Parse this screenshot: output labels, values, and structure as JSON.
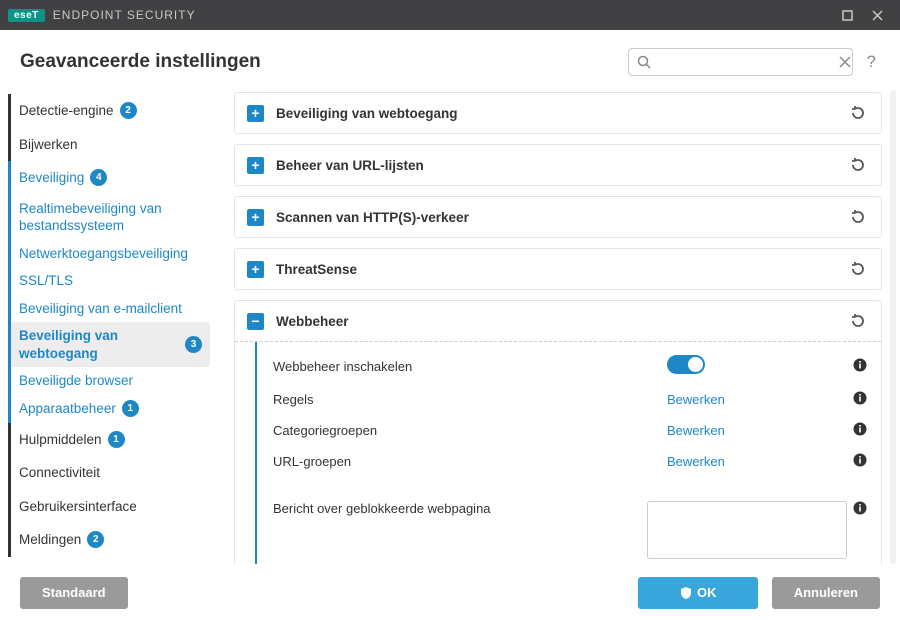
{
  "app": {
    "brand": "eseT",
    "name": "ENDPOINT SECURITY"
  },
  "page_title": "Geavanceerde instellingen",
  "search": {
    "placeholder": ""
  },
  "nav": {
    "detection": "Detectie-engine",
    "detection_badge": "2",
    "update": "Bijwerken",
    "protection": "Beveiliging",
    "protection_badge": "4",
    "sub_rtfs": "Realtimebeveiliging van bestandssysteem",
    "sub_network": "Netwerktoegangsbeveiliging",
    "sub_ssltls": "SSL/TLS",
    "sub_email": "Beveiliging van e-mailclient",
    "sub_webaccess": "Beveiliging van webtoegang",
    "sub_webaccess_badge": "3",
    "sub_secure_browser": "Beveiligde browser",
    "sub_device": "Apparaatbeheer",
    "sub_device_badge": "1",
    "tools": "Hulpmiddelen",
    "tools_badge": "1",
    "connectivity": "Connectiviteit",
    "ui": "Gebruikersinterface",
    "notifications": "Meldingen",
    "notifications_badge": "2"
  },
  "panels": {
    "web_security": "Beveiliging van webtoegang",
    "url_lists": "Beheer van URL-lijsten",
    "https_scan": "Scannen van HTTP(S)-verkeer",
    "threatsense": "ThreatSense",
    "webbeheer": "Webbeheer"
  },
  "webbeheer": {
    "enable_label": "Webbeheer inschakelen",
    "rules_label": "Regels",
    "rules_action": "Bewerken",
    "catgroups_label": "Categoriegroepen",
    "catgroups_action": "Bewerken",
    "urlgroups_label": "URL-groepen",
    "urlgroups_action": "Bewerken",
    "block_msg_label": "Bericht over geblokkeerde webpagina"
  },
  "footer": {
    "default": "Standaard",
    "ok": "OK",
    "cancel": "Annuleren"
  }
}
